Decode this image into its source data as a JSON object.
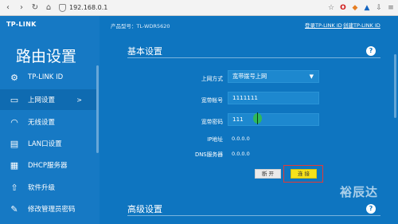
{
  "browser": {
    "url": "192.168.0.1",
    "nav": {
      "back": "‹",
      "forward": "›",
      "refresh": "↻",
      "home": "⌂"
    },
    "icons": [
      "star-icon",
      "opera-icon",
      "extension-icon",
      "shield-ext-icon",
      "download-icon",
      "menu-icon"
    ],
    "icon_glyphs": {
      "star": "☆",
      "opera": "O",
      "ext": "◆",
      "shield": "▲",
      "download": "⇩",
      "menu": "≡"
    }
  },
  "sidebar": {
    "logo": "TP-LINK",
    "title": "路由设置",
    "items": [
      {
        "label": "TP-LINK ID",
        "icon": "gear-icon",
        "glyph": "⚙"
      },
      {
        "label": "上网设置",
        "icon": "laptop-icon",
        "glyph": "▭",
        "arrow": ">"
      },
      {
        "label": "无线设置",
        "icon": "wifi-icon",
        "glyph": "◠"
      },
      {
        "label": "LAN口设置",
        "icon": "lan-icon",
        "glyph": "▤"
      },
      {
        "label": "DHCP服务器",
        "icon": "dhcp-icon",
        "glyph": "▦"
      },
      {
        "label": "软件升级",
        "icon": "upload-icon",
        "glyph": "⇧"
      },
      {
        "label": "修改管理员密码",
        "icon": "pencil-icon",
        "glyph": "✎"
      }
    ]
  },
  "main": {
    "model": "产品型号：TL-WDR5620",
    "link_tplink_id": "登录TP-LINK ID",
    "link_create_id": "创建TP-LINK ID",
    "basic_title": "基本设置",
    "help_glyph": "?",
    "form": {
      "mode_label": "上网方式",
      "mode_value": "宽带拨号上网",
      "mode_arrow": "▼",
      "account_label": "宽带帐号",
      "account_value": "1111111",
      "password_label": "宽带密码",
      "password_value": "111",
      "ip_label": "IP地址",
      "ip_value": "0.0.0.0",
      "dns_label": "DNS服务器",
      "dns_value": "0.0.0.0"
    },
    "disconnect_label": "断 开",
    "connect_label": "连 接",
    "advanced_title": "高级设置"
  },
  "watermark": "裕辰达",
  "colors": {
    "sidebar": "#1679c4",
    "main": "#0e75c0",
    "connect": "#f7e21a",
    "highlight": "#e53935"
  }
}
